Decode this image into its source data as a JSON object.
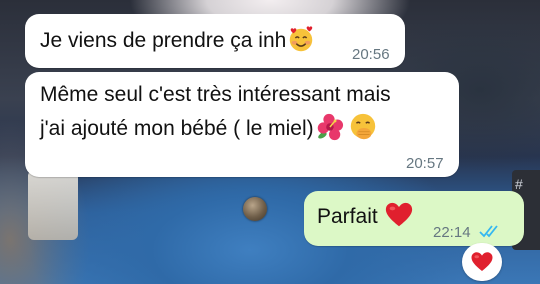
{
  "messages": [
    {
      "direction": "incoming",
      "text": "Je viens de prendre ça inh",
      "emoji": "smiling-face-with-hearts",
      "time": "20:56"
    },
    {
      "direction": "incoming",
      "line1": "Même seul c'est très intéressant mais",
      "line2": "j'ai ajouté mon bébé ( le miel)",
      "emojis": [
        "hibiscus",
        "face-with-hand-over-mouth"
      ],
      "time": "20:57"
    },
    {
      "direction": "outgoing",
      "text": "Parfait",
      "emoji": "red-heart",
      "time": "22:14",
      "status": "read"
    }
  ],
  "reaction": {
    "emoji": "red-heart"
  },
  "side_hint": "#",
  "colors": {
    "incoming_bubble": "#ffffff",
    "outgoing_bubble": "#dcf8c6",
    "timestamp": "#667781",
    "read_ticks": "#34b7f1",
    "heart": "#e0202e"
  }
}
